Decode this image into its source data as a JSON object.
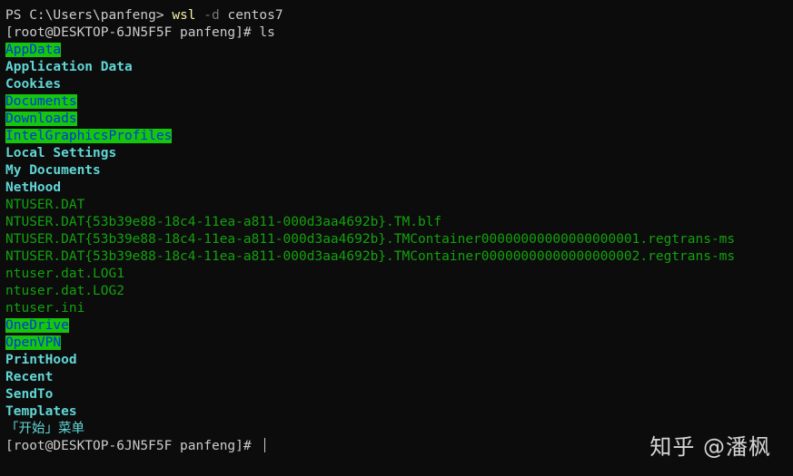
{
  "terminal": {
    "ps_prompt": "PS C:\\Users\\panfeng> ",
    "ps_command": "wsl",
    "ps_flag": " -d",
    "ps_arg": " centos7",
    "bash_prompt": "[root@DESKTOP-6JN5F5F panfeng]# ",
    "bash_command": "ls",
    "listing": [
      "AppData",
      "Application Data",
      "Cookies",
      "Documents",
      "Downloads",
      "IntelGraphicsProfiles",
      "Local Settings",
      "My Documents",
      "NetHood",
      "NTUSER.DAT",
      "NTUSER.DAT{53b39e88-18c4-11ea-a811-000d3aa4692b}.TM.blf",
      "NTUSER.DAT{53b39e88-18c4-11ea-a811-000d3aa4692b}.TMContainer00000000000000000001.regtrans-ms",
      "NTUSER.DAT{53b39e88-18c4-11ea-a811-000d3aa4692b}.TMContainer00000000000000000002.regtrans-ms",
      "ntuser.dat.LOG1",
      "ntuser.dat.LOG2",
      "ntuser.ini",
      "OneDrive",
      "OpenVPN",
      "PrintHood",
      "Recent",
      "SendTo",
      "Templates",
      "「开始」菜单"
    ],
    "final_prompt": "[root@DESKTOP-6JN5F5F panfeng]# "
  },
  "watermark": "知乎 @潘枫",
  "colors": {
    "background": "#0c0c0c",
    "directory": "#61d6d6",
    "directory_other_writable_bg": "#16c60c",
    "directory_other_writable_fg": "#0037da",
    "file": "#13a10e",
    "command": "#f9f1a5"
  }
}
